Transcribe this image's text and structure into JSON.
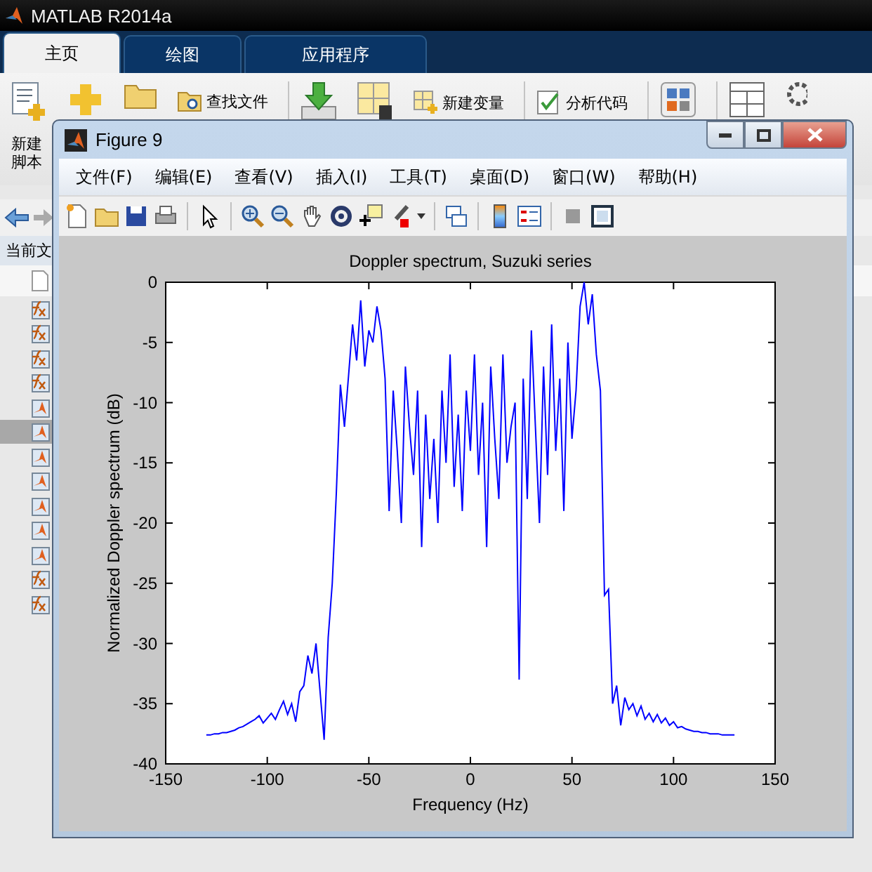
{
  "desktop": {
    "title": "MATLAB R2014a",
    "tabs": [
      {
        "label": "主页",
        "selected": true
      },
      {
        "label": "绘图",
        "selected": false
      },
      {
        "label": "应用程序",
        "selected": false
      }
    ],
    "toolstrip": [
      {
        "kind": "newscript",
        "label": "新建脚本"
      },
      {
        "kind": "new"
      },
      {
        "kind": "open"
      },
      {
        "kind": "findfiles",
        "label": "查找文件"
      },
      {
        "kind": "separator"
      },
      {
        "kind": "import"
      },
      {
        "kind": "saveworkspace"
      },
      {
        "kind": "newvariable",
        "label": "新建变量"
      },
      {
        "kind": "separator"
      },
      {
        "kind": "analyzecode",
        "label": "分析代码"
      },
      {
        "kind": "separator"
      },
      {
        "kind": "simulink"
      },
      {
        "kind": "separator"
      },
      {
        "kind": "layout"
      },
      {
        "kind": "gear"
      }
    ],
    "current_folder_label": "当前文",
    "files": [
      {
        "kind": "function",
        "selected": false
      },
      {
        "kind": "function",
        "selected": false
      },
      {
        "kind": "function",
        "selected": false
      },
      {
        "kind": "function",
        "selected": false
      },
      {
        "kind": "script",
        "selected": false
      },
      {
        "kind": "script",
        "selected": true
      },
      {
        "kind": "script",
        "selected": false
      },
      {
        "kind": "script",
        "selected": false
      },
      {
        "kind": "script",
        "selected": false
      },
      {
        "kind": "script",
        "selected": false
      },
      {
        "kind": "script",
        "selected": false
      },
      {
        "kind": "function",
        "selected": false
      },
      {
        "kind": "function",
        "selected": false
      }
    ]
  },
  "figure": {
    "title": "Figure 9",
    "menu": [
      "文件(F)",
      "编辑(E)",
      "查看(V)",
      "插入(I)",
      "工具(T)",
      "桌面(D)",
      "窗口(W)",
      "帮助(H)"
    ],
    "chart_data": {
      "type": "line",
      "title": "Doppler spectrum, Suzuki series",
      "xlabel": "Frequency (Hz)",
      "ylabel": "Normalized Doppler spectrum (dB)",
      "x": [
        -130,
        -128,
        -126,
        -124,
        -122,
        -120,
        -118,
        -116,
        -114,
        -112,
        -110,
        -108,
        -106,
        -104,
        -102,
        -100,
        -98,
        -96,
        -94,
        -92,
        -90,
        -88,
        -86,
        -84,
        -82,
        -80,
        -78,
        -76,
        -74,
        -72,
        -70,
        -68,
        -66,
        -64,
        -62,
        -60,
        -58,
        -56,
        -54,
        -52,
        -50,
        -48,
        -46,
        -44,
        -42,
        -40,
        -38,
        -36,
        -34,
        -32,
        -30,
        -28,
        -26,
        -24,
        -22,
        -20,
        -18,
        -16,
        -14,
        -12,
        -10,
        -8,
        -6,
        -4,
        -2,
        0,
        2,
        4,
        6,
        8,
        10,
        12,
        14,
        16,
        18,
        20,
        22,
        24,
        26,
        28,
        30,
        32,
        34,
        36,
        38,
        40,
        42,
        44,
        46,
        48,
        50,
        52,
        54,
        56,
        58,
        60,
        62,
        64,
        66,
        68,
        70,
        72,
        74,
        76,
        78,
        80,
        82,
        84,
        86,
        88,
        90,
        92,
        94,
        96,
        98,
        100,
        102,
        104,
        106,
        108,
        110,
        112,
        114,
        116,
        118,
        120,
        122,
        124,
        126,
        128,
        130
      ],
      "series": [
        {
          "color": "#0000ff",
          "values": [
            -37.6,
            -37.6,
            -37.5,
            -37.5,
            -37.4,
            -37.4,
            -37.3,
            -37.2,
            -37.0,
            -36.9,
            -36.7,
            -36.5,
            -36.3,
            -36.0,
            -36.6,
            -36.2,
            -35.8,
            -36.3,
            -35.5,
            -34.8,
            -35.9,
            -35.0,
            -36.5,
            -34.0,
            -33.5,
            -31.0,
            -32.5,
            -30.0,
            -34.0,
            -38.0,
            -29.5,
            -25.0,
            -17.5,
            -8.5,
            -12,
            -7.8,
            -3.5,
            -6.5,
            -1.5,
            -7,
            -4,
            -5,
            -2,
            -4,
            -8,
            -19,
            -9,
            -14,
            -20,
            -7,
            -12,
            -16,
            -9,
            -22,
            -11,
            -18,
            -13,
            -20,
            -9,
            -15,
            -6,
            -17,
            -11,
            -19,
            -9,
            -14,
            -6,
            -16,
            -10,
            -22,
            -7,
            -13,
            -18,
            -6,
            -15,
            -12,
            -10,
            -33,
            -8,
            -18,
            -4,
            -12,
            -20,
            -7,
            -16,
            -3.5,
            -14,
            -8,
            -19,
            -5,
            -13,
            -9,
            -2,
            0,
            -3.5,
            -1,
            -6,
            -9,
            -26,
            -25.5,
            -35,
            -33.5,
            -36.8,
            -34.5,
            -35.5,
            -35,
            -36.0,
            -35.2,
            -36.3,
            -35.8,
            -36.5,
            -35.9,
            -36.6,
            -36.2,
            -36.8,
            -36.5,
            -37.0,
            -36.9,
            -37.1,
            -37.2,
            -37.3,
            -37.3,
            -37.4,
            -37.4,
            -37.5,
            -37.5,
            -37.5,
            -37.6,
            -37.6,
            -37.6,
            -37.6
          ]
        }
      ],
      "xlim": [
        -150,
        150
      ],
      "ylim": [
        -40,
        0
      ],
      "xticks": [
        -150,
        -100,
        -50,
        0,
        50,
        100,
        150
      ],
      "yticks": [
        -40,
        -35,
        -30,
        -25,
        -20,
        -15,
        -10,
        -5,
        0
      ]
    }
  }
}
